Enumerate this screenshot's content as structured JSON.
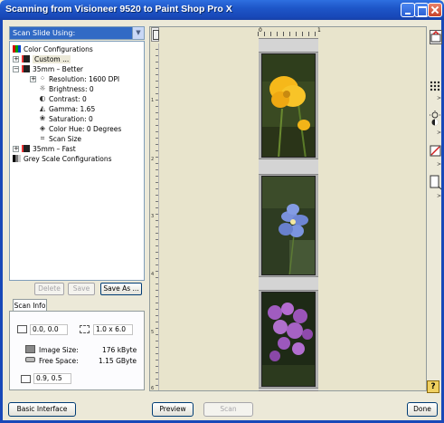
{
  "window": {
    "title": "Scanning from Visioneer 9520 to Paint Shop Pro X"
  },
  "left_panel": {
    "scan_using_select": {
      "value": "Scan Slide Using:"
    },
    "tree": [
      {
        "label": "Color Configurations",
        "icon": "color-config-icon",
        "level": 0,
        "expander": ""
      },
      {
        "label": "Custom ...",
        "icon": "film-icon",
        "level": 1,
        "expander": "+"
      },
      {
        "label": "35mm – Better",
        "icon": "film-icon",
        "level": 1,
        "expander": "−"
      },
      {
        "label": "Resolution: 1600 DPI",
        "icon": "resolution-icon",
        "level": 2,
        "expander": "+"
      },
      {
        "label": "Brightness: 0",
        "icon": "brightness-icon",
        "level": 2,
        "expander": ""
      },
      {
        "label": "Contrast: 0",
        "icon": "contrast-icon",
        "level": 2,
        "expander": ""
      },
      {
        "label": "Gamma: 1.65",
        "icon": "gamma-icon",
        "level": 2,
        "expander": ""
      },
      {
        "label": "Saturation: 0",
        "icon": "saturation-icon",
        "level": 2,
        "expander": ""
      },
      {
        "label": "Color Hue: 0 Degrees",
        "icon": "hue-icon",
        "level": 2,
        "expander": ""
      },
      {
        "label": "Scan Size",
        "icon": "scan-size-icon",
        "level": 2,
        "expander": ""
      },
      {
        "label": "35mm – Fast",
        "icon": "film-icon",
        "level": 1,
        "expander": "+"
      },
      {
        "label": "Grey Scale Configurations",
        "icon": "grayscale-icon",
        "level": 0,
        "expander": ""
      }
    ],
    "buttons": {
      "delete": "Delete",
      "save": "Save",
      "save_as": "Save As ..."
    }
  },
  "scan_info": {
    "tab_label": "Scan Info",
    "origin": "0.0, 0.0",
    "size": "1.0 x 6.0",
    "image_size_label": "Image Size:",
    "image_size_value": "176 kByte",
    "free_space_label": "Free Space:",
    "free_space_value": "1.15 GByte",
    "cursor_position": "0.9, 0.5"
  },
  "preview": {
    "hruler_labels": [
      "0",
      "1"
    ],
    "vruler_labels": [
      "1",
      "2",
      "3",
      "4",
      "5",
      "6"
    ],
    "photos": [
      {
        "subject": "yellow poppy flower"
      },
      {
        "subject": "blue flax flower"
      },
      {
        "subject": "purple phlox flowers"
      }
    ]
  },
  "right_toolbar": [
    {
      "icon": "apply-settings-icon"
    },
    {
      "icon": "dpi-grid-icon"
    },
    {
      "icon": "brightness-contrast-icon"
    },
    {
      "icon": "color-adjust-icon"
    },
    {
      "icon": "crop-size-icon"
    },
    {
      "icon": "help-icon"
    }
  ],
  "bottom_bar": {
    "basic_interface": "Basic Interface",
    "preview": "Preview",
    "scan": "Scan",
    "done": "Done"
  },
  "colors": {
    "title_bar": "#1e56c8",
    "selection": "#316ac5",
    "window_bg": "#ece9d8"
  }
}
